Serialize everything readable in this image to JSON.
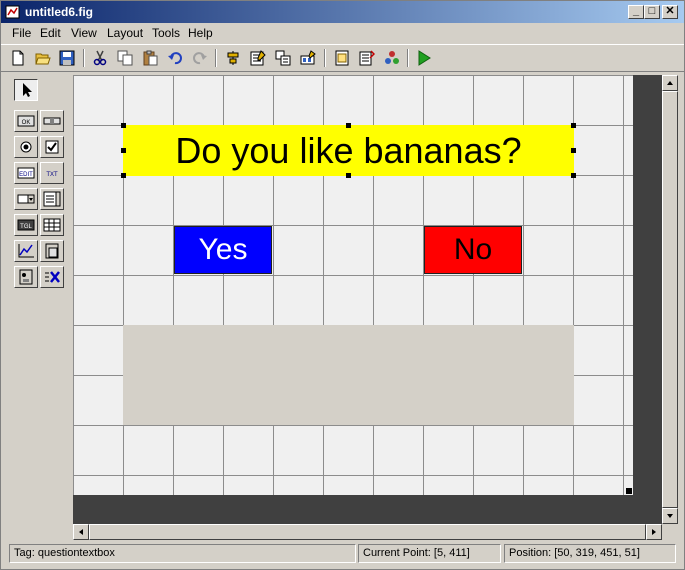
{
  "window": {
    "title": "untitled6.fig",
    "minimize": "_",
    "maximize": "□",
    "close": "✕"
  },
  "menu": [
    "File",
    "Edit",
    "View",
    "Layout",
    "Tools",
    "Help"
  ],
  "toolbar": {
    "buttons": [
      "new-figure-icon",
      "open-file-icon",
      "save-icon",
      "cut-icon",
      "copy-icon",
      "paste-icon",
      "undo-icon",
      "redo-icon",
      "align-objects-icon",
      "menu-editor-icon",
      "tab-order-editor-icon",
      "toolbar-editor-icon",
      "m-file-editor-icon",
      "property-inspector-icon",
      "object-browser-icon",
      "run-figure-icon"
    ]
  },
  "palette": {
    "tools": [
      "select-arrow-icon",
      "push-button-icon",
      "slider-icon",
      "radio-button-icon",
      "checkbox-icon",
      "edit-text-icon",
      "static-text-icon",
      "popup-menu-icon",
      "listbox-icon",
      "toggle-button-icon",
      "table-icon",
      "axes-icon",
      "panel-icon",
      "button-group-icon",
      "activex-control-icon"
    ],
    "labels": {
      "pushbutton": "OK",
      "edit": "EDIT",
      "text": "TXT",
      "toggle": "TGL"
    }
  },
  "canvas": {
    "question_text": "Do you like bananas?",
    "yes_label": "Yes",
    "no_label": "No",
    "colors": {
      "question_bg": "#ffff00",
      "yes_bg": "#0000ff",
      "no_bg": "#ff0000",
      "answer_bg": "#d4d0c8",
      "grid_bg": "#f0f0f0"
    }
  },
  "statusbar": {
    "tag": "Tag: questiontextbox",
    "current_point": "Current Point:  [5, 411]",
    "position": "Position: [50, 319, 451, 51]"
  }
}
